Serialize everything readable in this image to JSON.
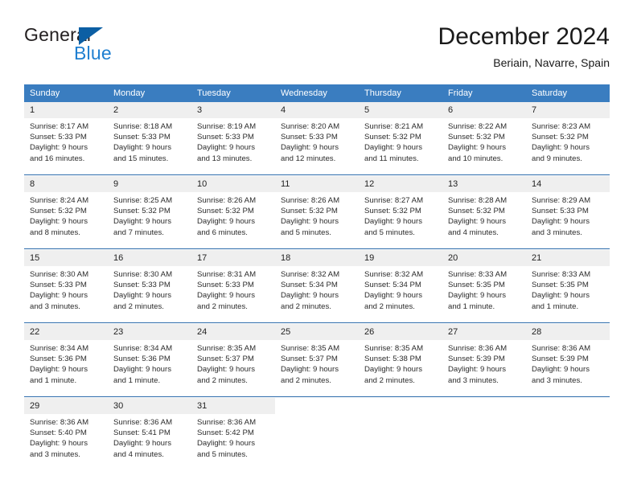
{
  "brand": {
    "word_general": "General",
    "word_blue": "Blue",
    "triangle_icon": "triangle-icon",
    "accent_blue": "#1f7fd0",
    "dark_blue": "#0c5fa4"
  },
  "header": {
    "title": "December 2024",
    "subtitle": "Beriain, Navarre, Spain"
  },
  "theme": {
    "header_bg": "#3a7dc0",
    "header_text": "#ffffff",
    "daynum_bg": "#efefef",
    "row_rule": "#2d6cab"
  },
  "columns": [
    "Sunday",
    "Monday",
    "Tuesday",
    "Wednesday",
    "Thursday",
    "Friday",
    "Saturday"
  ],
  "weeks": [
    {
      "days": [
        {
          "num": "1",
          "sunrise": "Sunrise: 8:17 AM",
          "sunset": "Sunset: 5:33 PM",
          "daylight1": "Daylight: 9 hours",
          "daylight2": "and 16 minutes."
        },
        {
          "num": "2",
          "sunrise": "Sunrise: 8:18 AM",
          "sunset": "Sunset: 5:33 PM",
          "daylight1": "Daylight: 9 hours",
          "daylight2": "and 15 minutes."
        },
        {
          "num": "3",
          "sunrise": "Sunrise: 8:19 AM",
          "sunset": "Sunset: 5:33 PM",
          "daylight1": "Daylight: 9 hours",
          "daylight2": "and 13 minutes."
        },
        {
          "num": "4",
          "sunrise": "Sunrise: 8:20 AM",
          "sunset": "Sunset: 5:33 PM",
          "daylight1": "Daylight: 9 hours",
          "daylight2": "and 12 minutes."
        },
        {
          "num": "5",
          "sunrise": "Sunrise: 8:21 AM",
          "sunset": "Sunset: 5:32 PM",
          "daylight1": "Daylight: 9 hours",
          "daylight2": "and 11 minutes."
        },
        {
          "num": "6",
          "sunrise": "Sunrise: 8:22 AM",
          "sunset": "Sunset: 5:32 PM",
          "daylight1": "Daylight: 9 hours",
          "daylight2": "and 10 minutes."
        },
        {
          "num": "7",
          "sunrise": "Sunrise: 8:23 AM",
          "sunset": "Sunset: 5:32 PM",
          "daylight1": "Daylight: 9 hours",
          "daylight2": "and 9 minutes."
        }
      ]
    },
    {
      "days": [
        {
          "num": "8",
          "sunrise": "Sunrise: 8:24 AM",
          "sunset": "Sunset: 5:32 PM",
          "daylight1": "Daylight: 9 hours",
          "daylight2": "and 8 minutes."
        },
        {
          "num": "9",
          "sunrise": "Sunrise: 8:25 AM",
          "sunset": "Sunset: 5:32 PM",
          "daylight1": "Daylight: 9 hours",
          "daylight2": "and 7 minutes."
        },
        {
          "num": "10",
          "sunrise": "Sunrise: 8:26 AM",
          "sunset": "Sunset: 5:32 PM",
          "daylight1": "Daylight: 9 hours",
          "daylight2": "and 6 minutes."
        },
        {
          "num": "11",
          "sunrise": "Sunrise: 8:26 AM",
          "sunset": "Sunset: 5:32 PM",
          "daylight1": "Daylight: 9 hours",
          "daylight2": "and 5 minutes."
        },
        {
          "num": "12",
          "sunrise": "Sunrise: 8:27 AM",
          "sunset": "Sunset: 5:32 PM",
          "daylight1": "Daylight: 9 hours",
          "daylight2": "and 5 minutes."
        },
        {
          "num": "13",
          "sunrise": "Sunrise: 8:28 AM",
          "sunset": "Sunset: 5:32 PM",
          "daylight1": "Daylight: 9 hours",
          "daylight2": "and 4 minutes."
        },
        {
          "num": "14",
          "sunrise": "Sunrise: 8:29 AM",
          "sunset": "Sunset: 5:33 PM",
          "daylight1": "Daylight: 9 hours",
          "daylight2": "and 3 minutes."
        }
      ]
    },
    {
      "days": [
        {
          "num": "15",
          "sunrise": "Sunrise: 8:30 AM",
          "sunset": "Sunset: 5:33 PM",
          "daylight1": "Daylight: 9 hours",
          "daylight2": "and 3 minutes."
        },
        {
          "num": "16",
          "sunrise": "Sunrise: 8:30 AM",
          "sunset": "Sunset: 5:33 PM",
          "daylight1": "Daylight: 9 hours",
          "daylight2": "and 2 minutes."
        },
        {
          "num": "17",
          "sunrise": "Sunrise: 8:31 AM",
          "sunset": "Sunset: 5:33 PM",
          "daylight1": "Daylight: 9 hours",
          "daylight2": "and 2 minutes."
        },
        {
          "num": "18",
          "sunrise": "Sunrise: 8:32 AM",
          "sunset": "Sunset: 5:34 PM",
          "daylight1": "Daylight: 9 hours",
          "daylight2": "and 2 minutes."
        },
        {
          "num": "19",
          "sunrise": "Sunrise: 8:32 AM",
          "sunset": "Sunset: 5:34 PM",
          "daylight1": "Daylight: 9 hours",
          "daylight2": "and 2 minutes."
        },
        {
          "num": "20",
          "sunrise": "Sunrise: 8:33 AM",
          "sunset": "Sunset: 5:35 PM",
          "daylight1": "Daylight: 9 hours",
          "daylight2": "and 1 minute."
        },
        {
          "num": "21",
          "sunrise": "Sunrise: 8:33 AM",
          "sunset": "Sunset: 5:35 PM",
          "daylight1": "Daylight: 9 hours",
          "daylight2": "and 1 minute."
        }
      ]
    },
    {
      "days": [
        {
          "num": "22",
          "sunrise": "Sunrise: 8:34 AM",
          "sunset": "Sunset: 5:36 PM",
          "daylight1": "Daylight: 9 hours",
          "daylight2": "and 1 minute."
        },
        {
          "num": "23",
          "sunrise": "Sunrise: 8:34 AM",
          "sunset": "Sunset: 5:36 PM",
          "daylight1": "Daylight: 9 hours",
          "daylight2": "and 1 minute."
        },
        {
          "num": "24",
          "sunrise": "Sunrise: 8:35 AM",
          "sunset": "Sunset: 5:37 PM",
          "daylight1": "Daylight: 9 hours",
          "daylight2": "and 2 minutes."
        },
        {
          "num": "25",
          "sunrise": "Sunrise: 8:35 AM",
          "sunset": "Sunset: 5:37 PM",
          "daylight1": "Daylight: 9 hours",
          "daylight2": "and 2 minutes."
        },
        {
          "num": "26",
          "sunrise": "Sunrise: 8:35 AM",
          "sunset": "Sunset: 5:38 PM",
          "daylight1": "Daylight: 9 hours",
          "daylight2": "and 2 minutes."
        },
        {
          "num": "27",
          "sunrise": "Sunrise: 8:36 AM",
          "sunset": "Sunset: 5:39 PM",
          "daylight1": "Daylight: 9 hours",
          "daylight2": "and 3 minutes."
        },
        {
          "num": "28",
          "sunrise": "Sunrise: 8:36 AM",
          "sunset": "Sunset: 5:39 PM",
          "daylight1": "Daylight: 9 hours",
          "daylight2": "and 3 minutes."
        }
      ]
    },
    {
      "days": [
        {
          "num": "29",
          "sunrise": "Sunrise: 8:36 AM",
          "sunset": "Sunset: 5:40 PM",
          "daylight1": "Daylight: 9 hours",
          "daylight2": "and 3 minutes."
        },
        {
          "num": "30",
          "sunrise": "Sunrise: 8:36 AM",
          "sunset": "Sunset: 5:41 PM",
          "daylight1": "Daylight: 9 hours",
          "daylight2": "and 4 minutes."
        },
        {
          "num": "31",
          "sunrise": "Sunrise: 8:36 AM",
          "sunset": "Sunset: 5:42 PM",
          "daylight1": "Daylight: 9 hours",
          "daylight2": "and 5 minutes."
        },
        {
          "num": "",
          "sunrise": "",
          "sunset": "",
          "daylight1": "",
          "daylight2": ""
        },
        {
          "num": "",
          "sunrise": "",
          "sunset": "",
          "daylight1": "",
          "daylight2": ""
        },
        {
          "num": "",
          "sunrise": "",
          "sunset": "",
          "daylight1": "",
          "daylight2": ""
        },
        {
          "num": "",
          "sunrise": "",
          "sunset": "",
          "daylight1": "",
          "daylight2": ""
        }
      ]
    }
  ]
}
